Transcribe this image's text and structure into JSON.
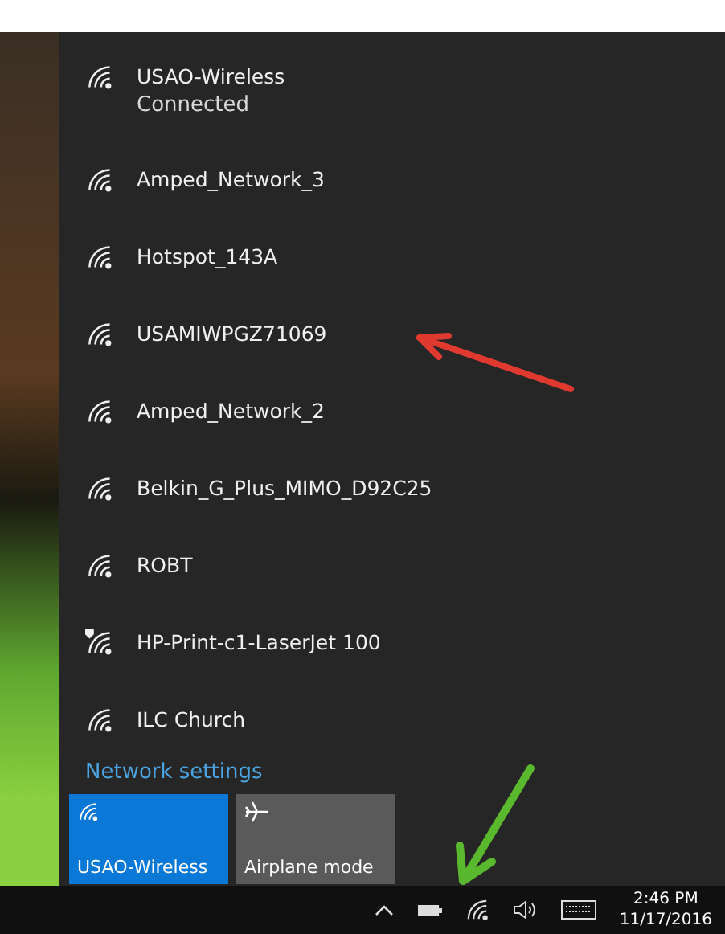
{
  "networks": [
    {
      "name": "USAO-Wireless",
      "status": "Connected",
      "warning": false
    },
    {
      "name": "Amped_Network_3",
      "warning": false
    },
    {
      "name": "Hotspot_143A",
      "warning": false
    },
    {
      "name": "USAMIWPGZ71069",
      "warning": false
    },
    {
      "name": "Amped_Network_2",
      "warning": false
    },
    {
      "name": "Belkin_G_Plus_MIMO_D92C25",
      "warning": false
    },
    {
      "name": "ROBT",
      "warning": false
    },
    {
      "name": "HP-Print-c1-LaserJet 100",
      "warning": true
    },
    {
      "name": "ILC Church",
      "warning": false
    }
  ],
  "network_settings": "Network settings",
  "quick_actions": [
    {
      "kind": "wifi",
      "label": "USAO-Wireless",
      "selected": true
    },
    {
      "kind": "airplane",
      "label": "Airplane mode",
      "selected": false
    }
  ],
  "taskbar": {
    "time": "2:46 PM",
    "date": "11/17/2016"
  }
}
